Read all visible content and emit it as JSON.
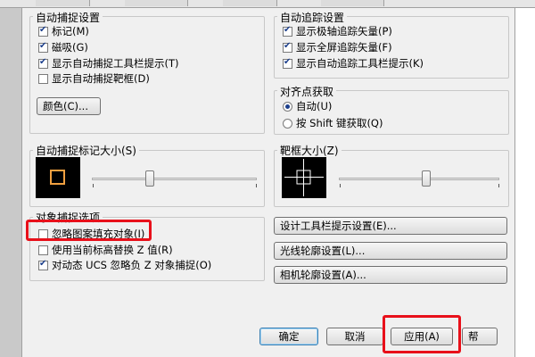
{
  "autosnap": {
    "title": "自动捕捉设置",
    "items": [
      {
        "label": "标记(M)",
        "checked": true
      },
      {
        "label": "磁吸(G)",
        "checked": true
      },
      {
        "label": "显示自动捕捉工具栏提示(T)",
        "checked": true
      },
      {
        "label": "显示自动捕捉靶框(D)",
        "checked": false
      }
    ],
    "color_button": "颜色(C)..."
  },
  "autotrack": {
    "title": "自动追踪设置",
    "items": [
      {
        "label": "显示极轴追踪矢量(P)",
        "checked": true
      },
      {
        "label": "显示全屏追踪矢量(F)",
        "checked": true
      },
      {
        "label": "显示自动追踪工具栏提示(K)",
        "checked": true
      }
    ]
  },
  "alignment": {
    "title": "对齐点获取",
    "options": [
      {
        "label": "自动(U)",
        "selected": true
      },
      {
        "label": "按 Shift 键获取(Q)",
        "selected": false
      }
    ]
  },
  "marker_size": {
    "title": "自动捕捉标记大小(S)"
  },
  "aperture_size": {
    "title": "靶框大小(Z)"
  },
  "object_snap": {
    "title": "对象捕捉选项",
    "items": [
      {
        "label": "忽略图案填充对象(I)",
        "checked": false
      },
      {
        "label": "使用当前标高替换 Z 值(R)",
        "checked": false
      },
      {
        "label": "对动态 UCS 忽略负 Z 对象捕捉(O)",
        "checked": true
      }
    ]
  },
  "side_buttons": {
    "drafting_tooltip": "设计工具栏提示设置(E)...",
    "lights_glyph": "光线轮廓设置(L)...",
    "cameras_glyph": "相机轮廓设置(A)..."
  },
  "footer": {
    "ok": "确定",
    "cancel": "取消",
    "apply": "应用(A)",
    "help_partial": "帮"
  },
  "colors": {
    "highlight": "#e8101a",
    "marker_square": "#f0a040",
    "check": "#1c3f8c"
  }
}
